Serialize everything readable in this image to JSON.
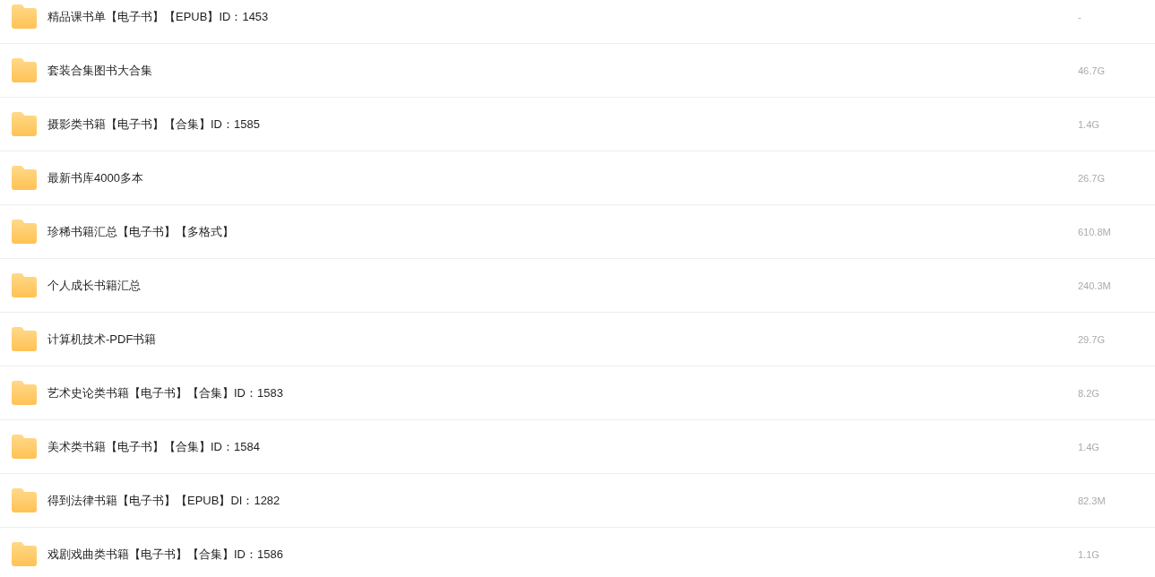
{
  "files": [
    {
      "name": "精品课书单【电子书】【EPUB】ID：1453",
      "size": "-"
    },
    {
      "name": "套装合集图书大合集",
      "size": "46.7G"
    },
    {
      "name": "摄影类书籍【电子书】【合集】ID：1585",
      "size": "1.4G"
    },
    {
      "name": "最新书库4000多本",
      "size": "26.7G"
    },
    {
      "name": "珍稀书籍汇总【电子书】【多格式】",
      "size": "610.8M"
    },
    {
      "name": "个人成长书籍汇总",
      "size": "240.3M"
    },
    {
      "name": "计算机技术-PDF书籍",
      "size": "29.7G"
    },
    {
      "name": "艺术史论类书籍【电子书】【合集】ID：1583",
      "size": "8.2G"
    },
    {
      "name": "美术类书籍【电子书】【合集】ID：1584",
      "size": "1.4G"
    },
    {
      "name": "得到法律书籍【电子书】【EPUB】DI：1282",
      "size": "82.3M"
    },
    {
      "name": "戏剧戏曲类书籍【电子书】【合集】ID：1586",
      "size": "1.1G"
    }
  ]
}
